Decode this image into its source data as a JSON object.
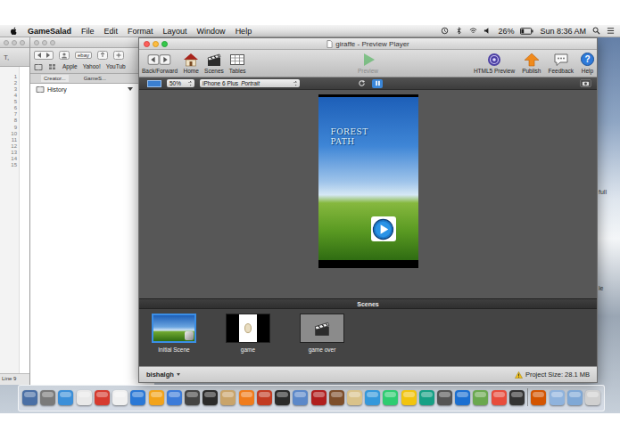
{
  "menu_bar": {
    "app": "GameSalad",
    "items": [
      "File",
      "Edit",
      "Format",
      "Layout",
      "Window",
      "Help"
    ],
    "battery": "26%",
    "clock": "Sun 8:36 AM"
  },
  "desktop_labels": [
    "full",
    "le"
  ],
  "editor_window": {
    "tool": "T,",
    "line_numbers": [
      "1",
      "2",
      "3",
      "4",
      "5",
      "6",
      "7",
      "8",
      "9",
      "10",
      "11",
      "12",
      "13",
      "14",
      "15"
    ],
    "status": "Line 9"
  },
  "browser_window": {
    "extension": "ebay",
    "bookmarks": [
      "Apple",
      "Yahoo!",
      "YouTub"
    ],
    "tabs": [
      {
        "label": "Creator...",
        "selected": true
      },
      {
        "label": "GameS...",
        "selected": false
      }
    ],
    "sidebar_items": [
      {
        "label": "History",
        "expanded": true
      }
    ]
  },
  "preview_window": {
    "title": "giraffe - Preview Player",
    "toolbar": [
      {
        "label": "Back/Forward",
        "kind": "backforward",
        "disabled": false
      },
      {
        "label": "Home",
        "kind": "home",
        "disabled": false
      },
      {
        "label": "Scenes",
        "kind": "scenes",
        "disabled": false
      },
      {
        "label": "Tables",
        "kind": "tables",
        "disabled": false
      },
      {
        "label": "Preview",
        "kind": "preview",
        "disabled": true
      },
      {
        "label": "HTML5 Preview",
        "kind": "html5",
        "disabled": false
      },
      {
        "label": "Publish",
        "kind": "publish",
        "disabled": false
      },
      {
        "label": "Feedback",
        "kind": "feedback",
        "disabled": false
      },
      {
        "label": "Help",
        "kind": "help",
        "disabled": false,
        "glyph": "?"
      }
    ],
    "zoom": "50%",
    "device": "iPhone 6 Plus",
    "orientation": "Portrait",
    "playback_controls": [
      {
        "kind": "reload",
        "selected": false
      },
      {
        "kind": "pause",
        "selected": true
      }
    ],
    "game_preview": {
      "title_lines": [
        "FOREST",
        "PATH"
      ]
    },
    "scenes_header": "Scenes",
    "scenes": [
      {
        "label": "Initial Scene",
        "kind": "sky",
        "selected": true
      },
      {
        "label": "game",
        "kind": "fingerprint",
        "selected": false
      },
      {
        "label": "game over",
        "kind": "empty",
        "selected": false
      }
    ],
    "user": "bishalgh",
    "project_size": "Project Size: 28.1 MB"
  }
}
